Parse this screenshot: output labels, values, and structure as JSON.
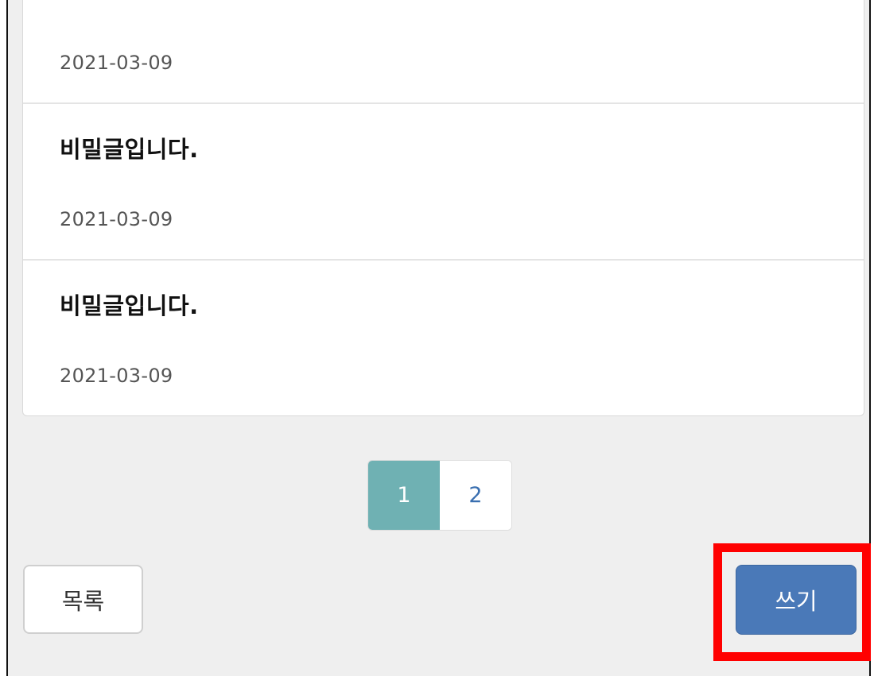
{
  "posts": [
    {
      "title": "",
      "date": "2021-03-09"
    },
    {
      "title": "비밀글입니다.",
      "date": "2021-03-09"
    },
    {
      "title": "비밀글입니다.",
      "date": "2021-03-09"
    }
  ],
  "pagination": {
    "pages": [
      "1",
      "2"
    ],
    "current": "1"
  },
  "buttons": {
    "list_label": "목록",
    "write_label": "쓰기"
  },
  "colors": {
    "page_background": "#efefef",
    "pagination_active": "#6fb1b3",
    "write_button": "#4a79b8",
    "highlight": "#ff0000"
  }
}
